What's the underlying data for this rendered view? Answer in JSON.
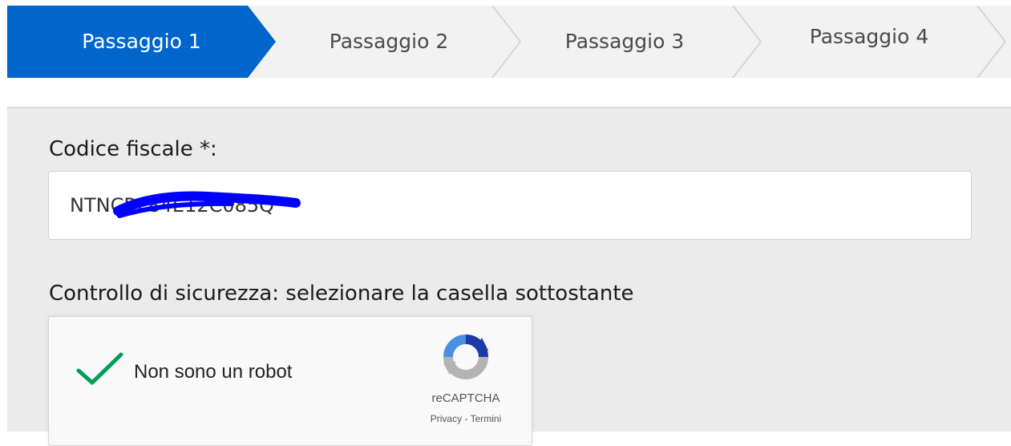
{
  "stepper": {
    "steps": [
      {
        "label": "Passaggio 1",
        "active": true
      },
      {
        "label": "Passaggio 2",
        "active": false
      },
      {
        "label": "Passaggio 3",
        "active": false
      },
      {
        "label": "Passaggio 4",
        "active": false
      }
    ]
  },
  "form": {
    "codice_fiscale_label": "Codice fiscale *:",
    "codice_fiscale_value": "NTNCRL84E12C085Q",
    "security_label": "Controllo di sicurezza: selezionare la casella sottostante"
  },
  "recaptcha": {
    "label": "Non sono un robot",
    "checked": true,
    "brand": "reCAPTCHA",
    "privacy_label": "Privacy",
    "separator": " - ",
    "terms_label": "Termini",
    "icon": "recaptcha-logo-icon"
  },
  "colors": {
    "active_step": "#0066cc",
    "inactive_step": "#f2f2f2",
    "panel": "#ebebeb",
    "check": "#009e55",
    "redaction": "#0000ff"
  }
}
